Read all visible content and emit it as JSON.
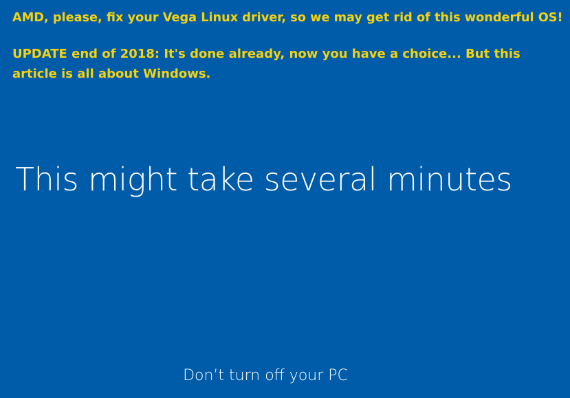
{
  "overlay": {
    "line1": "AMD, please, fix your Vega Linux driver, so we may get rid of this wonderful  OS!",
    "line2": "UPDATE end of 2018: It's done already, now you have a choice... But this",
    "line3": "article is all about Windows."
  },
  "status": {
    "main_message": "This might take several minutes",
    "sub_message": "Don’t turn off your PC"
  },
  "colors": {
    "background": "#005ca8",
    "overlay_text": "#f5d20f",
    "message_text": "#ffffff"
  }
}
